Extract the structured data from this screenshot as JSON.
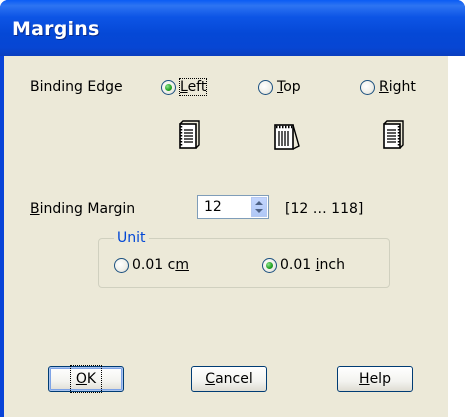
{
  "window": {
    "title": "Margins"
  },
  "binding_edge": {
    "label": "Binding Edge",
    "options": [
      {
        "label": "Left",
        "selected": true
      },
      {
        "label": "Top",
        "selected": false
      },
      {
        "label": "Right",
        "selected": false
      }
    ]
  },
  "binding_margin": {
    "label": "Binding Margin",
    "value": "12",
    "range": "[12 … 118]"
  },
  "unit": {
    "group_title": "Unit",
    "options": [
      {
        "label": "0.01 cm",
        "selected": false
      },
      {
        "label": "0.01 inch",
        "selected": true
      }
    ]
  },
  "buttons": {
    "ok": "OK",
    "cancel": "Cancel",
    "help": "Help"
  },
  "colors": {
    "title_bar": "#0548d6",
    "dialog_bg": "#ece9d8",
    "group_title": "#0046d5",
    "radio_selected": "#21a121"
  }
}
